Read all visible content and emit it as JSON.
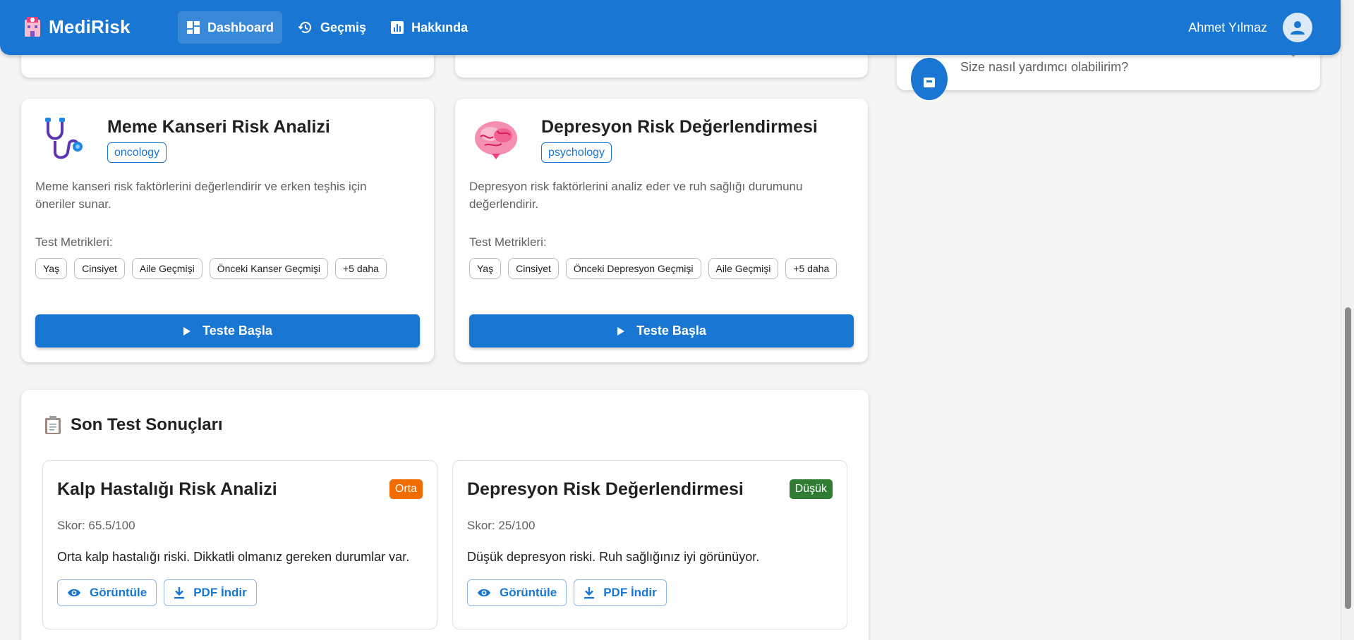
{
  "app": {
    "brand": "MediRisk"
  },
  "nav": {
    "items": [
      {
        "label": "Dashboard",
        "icon": "dashboard-icon",
        "active": true
      },
      {
        "label": "Geçmiş",
        "icon": "history-icon",
        "active": false
      },
      {
        "label": "Hakkında",
        "icon": "chart-icon",
        "active": false
      }
    ]
  },
  "user": {
    "name": "Ahmet Yılmaz"
  },
  "assistant": {
    "subtitle": "Size nasıl yardımcı olabilirim?"
  },
  "tests": [
    {
      "title": "Meme Kanseri Risk Analizi",
      "category": "oncology",
      "icon": "stethoscope-icon",
      "description": "Meme kanseri risk faktörlerini değerlendirir ve erken teşhis için öneriler sunar.",
      "metrics_label": "Test Metrikleri:",
      "metrics": [
        "Yaş",
        "Cinsiyet",
        "Aile Geçmişi",
        "Önceki Kanser Geçmişi",
        "+5 daha"
      ],
      "button": "Teste Başla"
    },
    {
      "title": "Depresyon Risk Değerlendirmesi",
      "category": "psychology",
      "icon": "brain-icon",
      "description": "Depresyon risk faktörlerini analiz eder ve ruh sağlığı durumunu değerlendirir.",
      "metrics_label": "Test Metrikleri:",
      "metrics": [
        "Yaş",
        "Cinsiyet",
        "Önceki Depresyon Geçmişi",
        "Aile Geçmişi",
        "+5 daha"
      ],
      "button": "Teste Başla"
    }
  ],
  "recent": {
    "heading": "Son Test Sonuçları",
    "results": [
      {
        "title": "Kalp Hastalığı Risk Analizi",
        "badge": "Orta",
        "badge_color": "#ef6c00",
        "score": "Skor: 65.5/100",
        "message": "Orta kalp hastalığı riski. Dikkatli olmanız gereken durumlar var.",
        "view": "Görüntüle",
        "pdf": "PDF İndir"
      },
      {
        "title": "Depresyon Risk Değerlendirmesi",
        "badge": "Düşük",
        "badge_color": "#2e7d32",
        "score": "Skor: 25/100",
        "message": "Düşük depresyon riski. Ruh sağlığınız iyi görünüyor.",
        "view": "Görüntüle",
        "pdf": "PDF İndir"
      }
    ]
  },
  "colors": {
    "primary": "#1976d2",
    "background": "#f5f5f5"
  }
}
